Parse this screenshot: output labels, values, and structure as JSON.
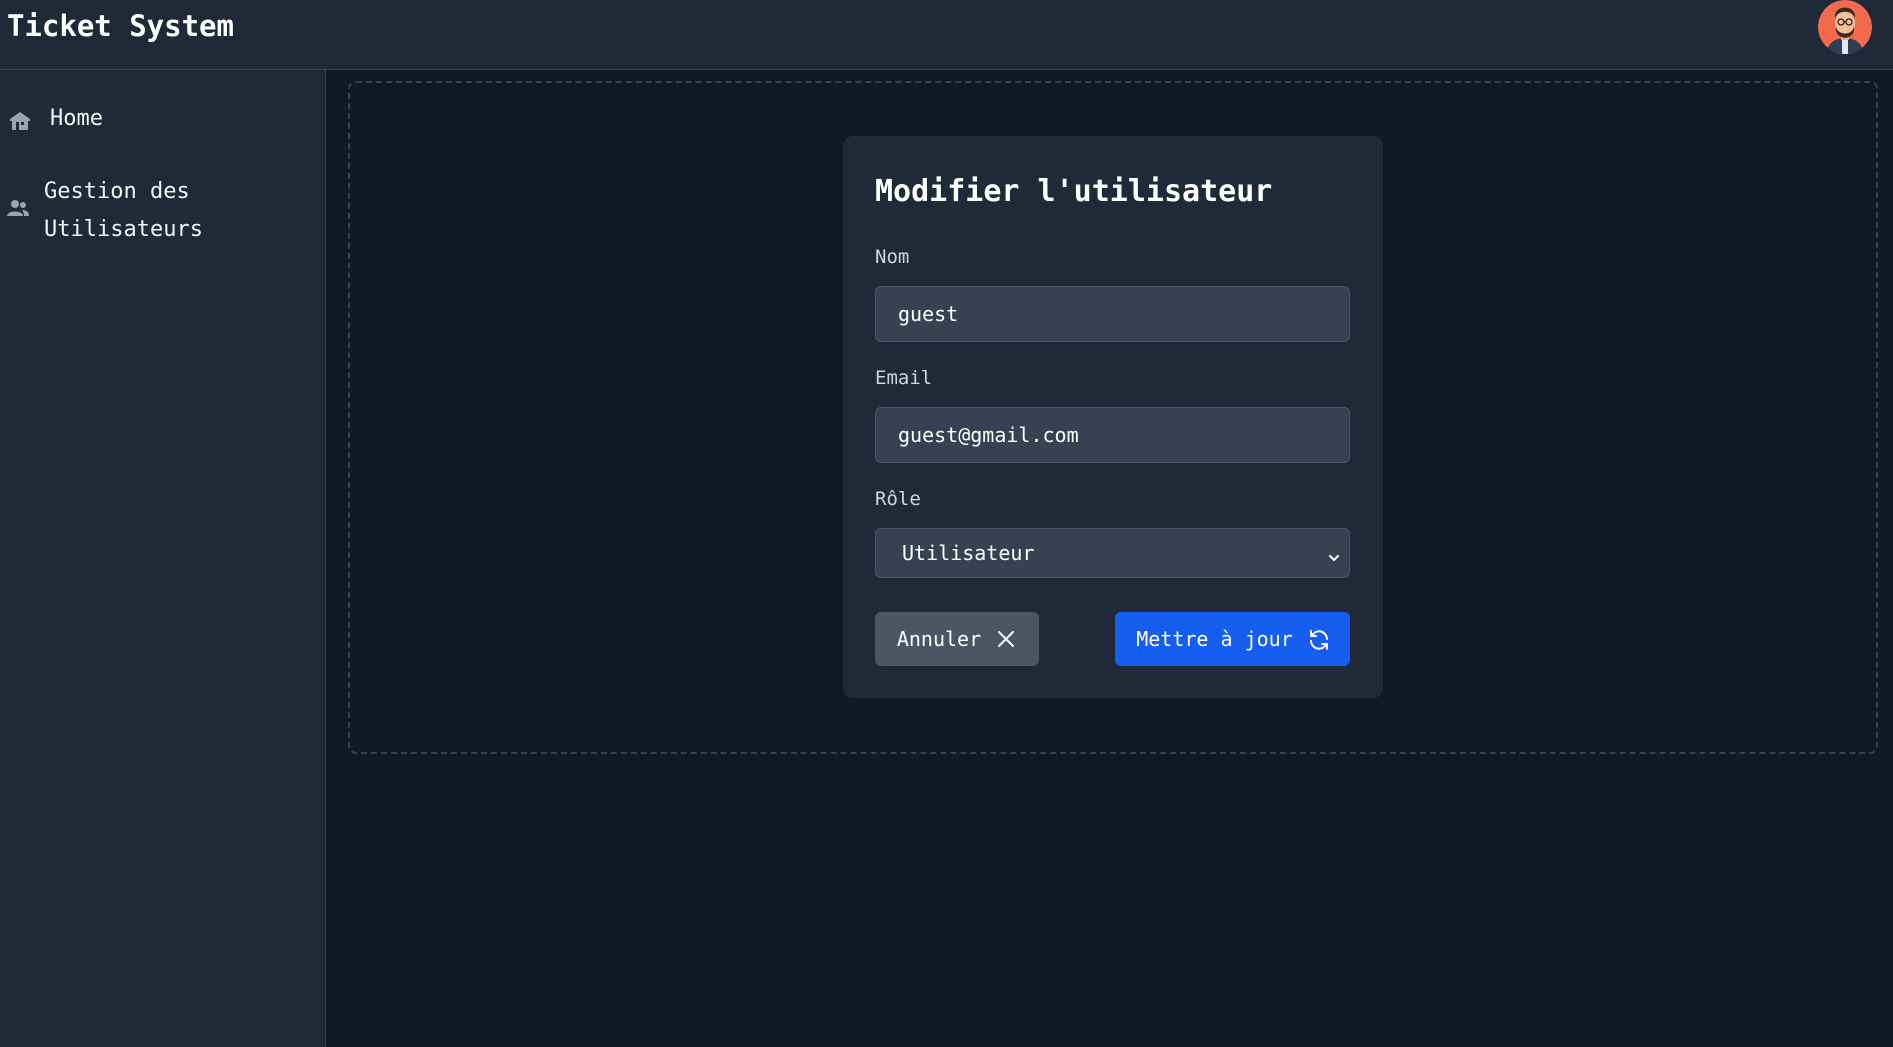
{
  "header": {
    "app_title": "Ticket System"
  },
  "sidebar": {
    "items": [
      {
        "label": "Home",
        "icon": "home-icon"
      },
      {
        "label": "Gestion des Utilisateurs",
        "icon": "users-icon"
      }
    ]
  },
  "form": {
    "title": "Modifier l'utilisateur",
    "name_label": "Nom",
    "name_value": "guest",
    "email_label": "Email",
    "email_value": "guest@gmail.com",
    "role_label": "Rôle",
    "role_value": "Utilisateur",
    "cancel_label": "Annuler",
    "update_label": "Mettre à jour"
  },
  "colors": {
    "background": "#111827",
    "panel": "#1f2937",
    "input": "#374151",
    "primary": "#155eef",
    "secondary": "#4b5563",
    "avatar_bg": "#f26b4f"
  }
}
